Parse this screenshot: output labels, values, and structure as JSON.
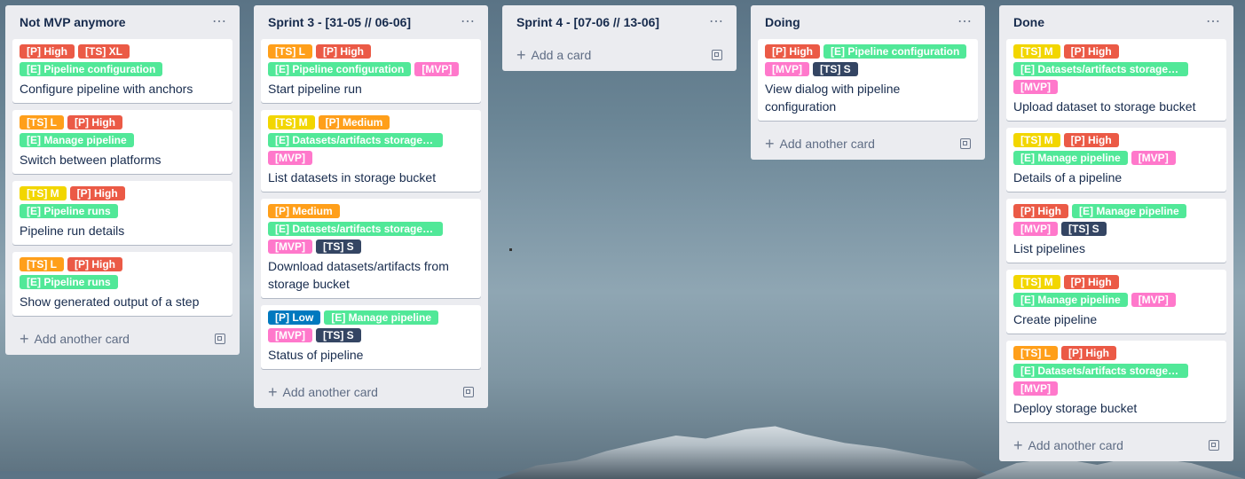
{
  "colors": {
    "red": "#eb5a46",
    "orange": "#ff9f1a",
    "yellow": "#f2d600",
    "green": "#51e898",
    "pink": "#ff78cb",
    "navy": "#344563",
    "blue": "#0079bf"
  },
  "lists": [
    {
      "title": "Not MVP anymore",
      "add_label": "Add another card",
      "cards": [
        {
          "labels": [
            {
              "text": "[P] High",
              "color": "red"
            },
            {
              "text": "[TS] XL",
              "color": "red"
            },
            {
              "text": "[E] Pipeline configuration",
              "color": "green"
            }
          ],
          "title": "Configure pipeline with anchors"
        },
        {
          "labels": [
            {
              "text": "[TS] L",
              "color": "orange"
            },
            {
              "text": "[P] High",
              "color": "red"
            },
            {
              "text": "[E] Manage pipeline",
              "color": "green"
            }
          ],
          "title": "Switch between platforms"
        },
        {
          "labels": [
            {
              "text": "[TS] M",
              "color": "yellow"
            },
            {
              "text": "[P] High",
              "color": "red"
            },
            {
              "text": "[E] Pipeline runs",
              "color": "green"
            }
          ],
          "title": "Pipeline run details"
        },
        {
          "labels": [
            {
              "text": "[TS] L",
              "color": "orange"
            },
            {
              "text": "[P] High",
              "color": "red"
            },
            {
              "text": "[E] Pipeline runs",
              "color": "green"
            }
          ],
          "title": "Show generated output of a step"
        }
      ]
    },
    {
      "title": "Sprint 3 - [31-05 // 06-06]",
      "add_label": "Add another card",
      "cards": [
        {
          "labels": [
            {
              "text": "[TS] L",
              "color": "orange"
            },
            {
              "text": "[P] High",
              "color": "red"
            },
            {
              "text": "[E] Pipeline configuration",
              "color": "green"
            },
            {
              "text": "[MVP]",
              "color": "pink"
            }
          ],
          "title": "Start pipeline run"
        },
        {
          "labels": [
            {
              "text": "[TS] M",
              "color": "yellow"
            },
            {
              "text": "[P] Medium",
              "color": "orange"
            },
            {
              "text": "[E] Datasets/artifacts storage bucket",
              "color": "green"
            },
            {
              "text": "[MVP]",
              "color": "pink"
            }
          ],
          "title": "List datasets in storage bucket"
        },
        {
          "labels": [
            {
              "text": "[P] Medium",
              "color": "orange"
            },
            {
              "text": "[E] Datasets/artifacts storage bucket",
              "color": "green"
            },
            {
              "text": "[MVP]",
              "color": "pink"
            },
            {
              "text": "[TS] S",
              "color": "navy"
            }
          ],
          "title": "Download datasets/artifacts from storage bucket"
        },
        {
          "labels": [
            {
              "text": "[P] Low",
              "color": "blue"
            },
            {
              "text": "[E] Manage pipeline",
              "color": "green"
            },
            {
              "text": "[MVP]",
              "color": "pink"
            },
            {
              "text": "[TS] S",
              "color": "navy"
            }
          ],
          "title": "Status of pipeline"
        }
      ]
    },
    {
      "title": "Sprint 4 - [07-06 // 13-06]",
      "add_label": "Add a card",
      "cards": []
    },
    {
      "title": "Doing",
      "add_label": "Add another card",
      "cards": [
        {
          "labels": [
            {
              "text": "[P] High",
              "color": "red"
            },
            {
              "text": "[E] Pipeline configuration",
              "color": "green"
            },
            {
              "text": "[MVP]",
              "color": "pink"
            },
            {
              "text": "[TS] S",
              "color": "navy"
            }
          ],
          "title": "View dialog with pipeline configuration"
        }
      ]
    },
    {
      "title": "Done",
      "add_label": "Add another card",
      "cards": [
        {
          "labels": [
            {
              "text": "[TS] M",
              "color": "yellow"
            },
            {
              "text": "[P] High",
              "color": "red"
            },
            {
              "text": "[E] Datasets/artifacts storage bucket",
              "color": "green"
            },
            {
              "text": "[MVP]",
              "color": "pink"
            }
          ],
          "title": "Upload dataset to storage bucket"
        },
        {
          "labels": [
            {
              "text": "[TS] M",
              "color": "yellow"
            },
            {
              "text": "[P] High",
              "color": "red"
            },
            {
              "text": "[E] Manage pipeline",
              "color": "green"
            },
            {
              "text": "[MVP]",
              "color": "pink"
            }
          ],
          "title": "Details of a pipeline"
        },
        {
          "labels": [
            {
              "text": "[P] High",
              "color": "red"
            },
            {
              "text": "[E] Manage pipeline",
              "color": "green"
            },
            {
              "text": "[MVP]",
              "color": "pink"
            },
            {
              "text": "[TS] S",
              "color": "navy"
            }
          ],
          "title": "List pipelines"
        },
        {
          "labels": [
            {
              "text": "[TS] M",
              "color": "yellow"
            },
            {
              "text": "[P] High",
              "color": "red"
            },
            {
              "text": "[E] Manage pipeline",
              "color": "green"
            },
            {
              "text": "[MVP]",
              "color": "pink"
            }
          ],
          "title": "Create pipeline"
        },
        {
          "labels": [
            {
              "text": "[TS] L",
              "color": "orange"
            },
            {
              "text": "[P] High",
              "color": "red"
            },
            {
              "text": "[E] Datasets/artifacts storage bucket",
              "color": "green"
            },
            {
              "text": "[MVP]",
              "color": "pink"
            }
          ],
          "title": "Deploy storage bucket"
        }
      ]
    }
  ]
}
